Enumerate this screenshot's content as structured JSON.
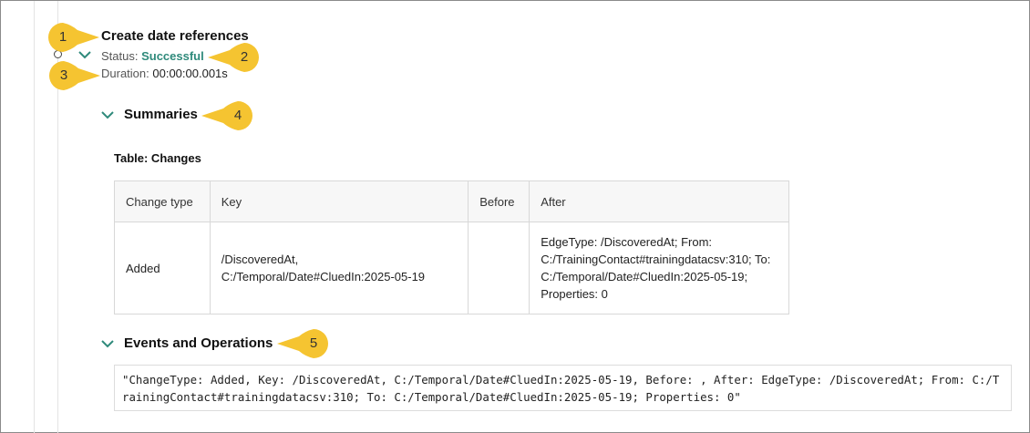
{
  "step": {
    "title": "Create date references",
    "status_label": "Status: ",
    "status_value": "Successful",
    "duration_label": "Duration: ",
    "duration_value": "00:00:00.001s"
  },
  "summaries": {
    "heading": "Summaries",
    "table_caption": "Table:  Changes",
    "columns": [
      "Change type",
      "Key",
      "Before",
      "After"
    ],
    "rows": [
      {
        "change_type": "Added",
        "key": "/DiscoveredAt,\nC:/Temporal/Date#CluedIn:2025-05-19",
        "before": "",
        "after": "EdgeType: /DiscoveredAt; From: C:/TrainingContact#trainingdatacsv:310; To: C:/Temporal/Date#CluedIn:2025-05-19; Properties: 0"
      }
    ]
  },
  "events": {
    "heading": "Events and Operations",
    "log": "\"ChangeType: Added, Key: /DiscoveredAt, C:/Temporal/Date#CluedIn:2025-05-19, Before: , After: EdgeType: /DiscoveredAt; From: C:/TrainingContact#trainingdatacsv:310; To: C:/Temporal/Date#CluedIn:2025-05-19; Properties: 0\""
  },
  "callouts": [
    "1",
    "2",
    "3",
    "4",
    "5"
  ],
  "colors": {
    "accent": "#2f8a7b",
    "callout": "#f5c431",
    "border": "#d8d8d8"
  },
  "icons": {
    "node": "timeline-node-icon",
    "chevron": "chevron-down-icon"
  }
}
